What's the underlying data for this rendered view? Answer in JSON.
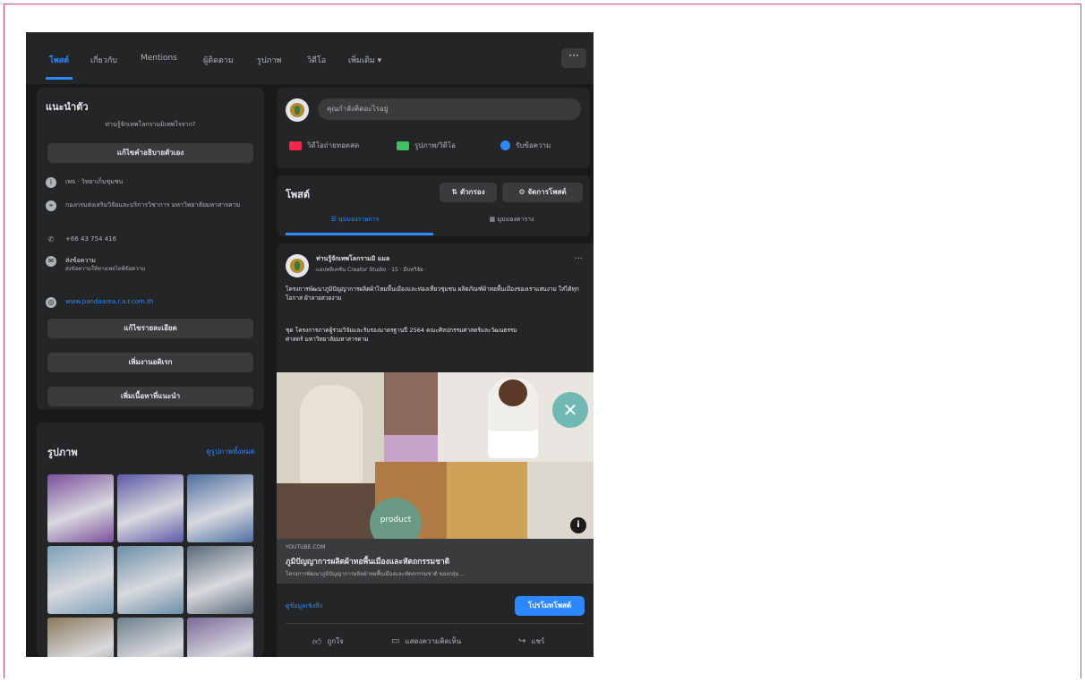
{
  "nav": {
    "tabs": [
      "โพสต์",
      "เกี่ยวกับ",
      "Mentions",
      "ผู้ติดตาม",
      "รูปภาพ",
      "วิดีโอ",
      "เพิ่มเติม ▾"
    ],
    "more": "···"
  },
  "intro": {
    "title": "แนะนำตัว",
    "question": "ท่านรู้จักเทพโลกรามมิเทพไรจาก?",
    "edit_intro_btn": "แก้ไขคำอธิบายตัวเอง",
    "rows": [
      {
        "icon": "info-icon",
        "text": "เพจ · วิทยาเก็บชุมชน"
      },
      {
        "icon": "pin-icon",
        "text": "กองกรมส่งเสริมวิจัยและบริการวิชาการ มหาวิทยาลัยมหาสารคาม"
      },
      {
        "icon": "phone-icon",
        "text": "+66 43 754 416"
      },
      {
        "icon": "message-icon",
        "text": "ส่งข้อความ",
        "sub": "ส่งข้อความให้ทางเพจไลฟ์ข้อความ"
      },
      {
        "icon": "globe-icon",
        "text": "www.pandaarea.r.a.r.com.th",
        "is_link": true
      }
    ],
    "edit_details_btn": "แก้ไขรายละเอียด",
    "add_hobbies_btn": "เพิ่มงานอดิเรก",
    "add_featured_btn": "เพิ่มเนื้อหาที่แนะนำ"
  },
  "photos": {
    "title": "รูปภาพ",
    "see_all": "ดูรูปภาพทั้งหมด",
    "tiles": [
      "#7a4f9c",
      "#5c5aa8",
      "#4d6fa3",
      "#7da0b8",
      "#6b8fa6",
      "#5a6b78",
      "#8a7a5a",
      "#6d7f8a",
      "#7a6a9a"
    ]
  },
  "composer": {
    "placeholder": "คุณกำลังคิดอะไรอยู่",
    "live": "วิดีโอถ่ายทอดสด",
    "photo": "รูปภาพ/วิดีโอ",
    "message": "รับข้อความ"
  },
  "posts_header": {
    "title": "โพสต์",
    "filter": "ตัวกรอง",
    "manage": "จัดการโพสต์",
    "list_view": "มุมมองรายการ",
    "grid_view": "มุมมองตาราง"
  },
  "post": {
    "page_name": "ท่านรู้จักเทพโลกรามมิ แมล",
    "meta": "แอปพลิเคชัน Creator Studio · 15 · มีบทวิจัย ·",
    "body": "โครงการพัฒนาภูมิปัญญาการผลิตผ้าไหมพื้นเมืองและท่องเที่ยวชุมชน ผลิตภัณฑ์ผ้าทอพื้นเมืองของเราแสนงาม ใส่ได้ทุกโอกาส ผ้าลายสวยงาม",
    "body2": "ชุด โครงการภาคผู้ร่วมวิจัยและรับรองมาตรฐานปี 2564 คณะศิลปกรรมศาสตร์และวัฒนธรรมศาสตร์ มหาวิทยาลัยมหาสารคาม",
    "product_label": "product",
    "link_domain": "YOUTUBE.COM",
    "link_title": "ภูมิปัญญาการผลิตผ้าทอพื้นเมืองและหัตถกรรมชาติ",
    "link_desc": "โครงการพัฒนาภูมิปัญญาการผลิตผ้าทอพื้นเมืองและหัตถกรรมชาติ ของกลุ่ม...",
    "insights": "ดูข้อมูลเชิงลึก",
    "boost": "โปรโมทโพสต์",
    "like": "ถูกใจ",
    "comment": "แสดงความคิดเห็น",
    "share": "แชร์"
  },
  "colors": {
    "accent": "#2d88ff",
    "card": "#242526",
    "background": "#18191a"
  }
}
